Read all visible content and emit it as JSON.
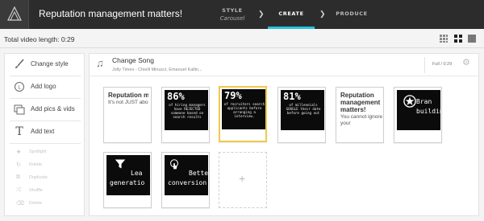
{
  "header": {
    "title": "Reputation management matters!",
    "steps": [
      {
        "label": "STYLE",
        "sub": "Carousel"
      },
      {
        "label": "CREATE",
        "sub": ""
      },
      {
        "label": "PRODUCE",
        "sub": ""
      }
    ],
    "accent": "#27c3d8"
  },
  "subbar": {
    "video_length": "Total video length: 0:29"
  },
  "sidebar": {
    "items": [
      {
        "label": "Change style",
        "icon": "paintbrush-icon"
      },
      {
        "label": "Add logo",
        "icon": "logo-icon"
      },
      {
        "label": "Add pics & vids",
        "icon": "media-icon"
      },
      {
        "label": "Add text",
        "icon": "text-icon"
      }
    ],
    "disabled_items": [
      {
        "label": "Spotlight",
        "icon": "star-icon"
      },
      {
        "label": "Rotate",
        "icon": "rotate-icon"
      },
      {
        "label": "Duplicate",
        "icon": "duplicate-icon"
      },
      {
        "label": "Shuffle",
        "icon": "shuffle-icon"
      },
      {
        "label": "Delete",
        "icon": "trash-icon"
      }
    ]
  },
  "song": {
    "title": "Change Song",
    "subtitle": "Jolly Times - Chielli Minucci, Emanuel Kallin...",
    "duration": "Full / 0:29"
  },
  "cards": {
    "c1": {
      "title": "Reputation managemen goals",
      "body": "It's not JUST about"
    },
    "c2": {
      "big": "86%",
      "small": "of hiring managers have REJECTED someone based on search results"
    },
    "c3": {
      "big": "79%",
      "small": "of recruiters search applicants before arranging a interview."
    },
    "c4": {
      "big": "81%",
      "small": "of millennials GOOGLE their date before going out"
    },
    "c5": {
      "title": "Reputation management matters!",
      "body": "You cannot ignore your"
    },
    "c6": {
      "line1": "Bran",
      "line2": "buildin"
    },
    "c7": {
      "line1": "Lea",
      "line2": "generatio"
    },
    "c8": {
      "line1": "Bette",
      "line2": "conversion"
    }
  },
  "add_card": {
    "symbol": "+"
  },
  "colors": {
    "selected_border": "#f1c84a",
    "topbar": "#2c2c2c"
  }
}
